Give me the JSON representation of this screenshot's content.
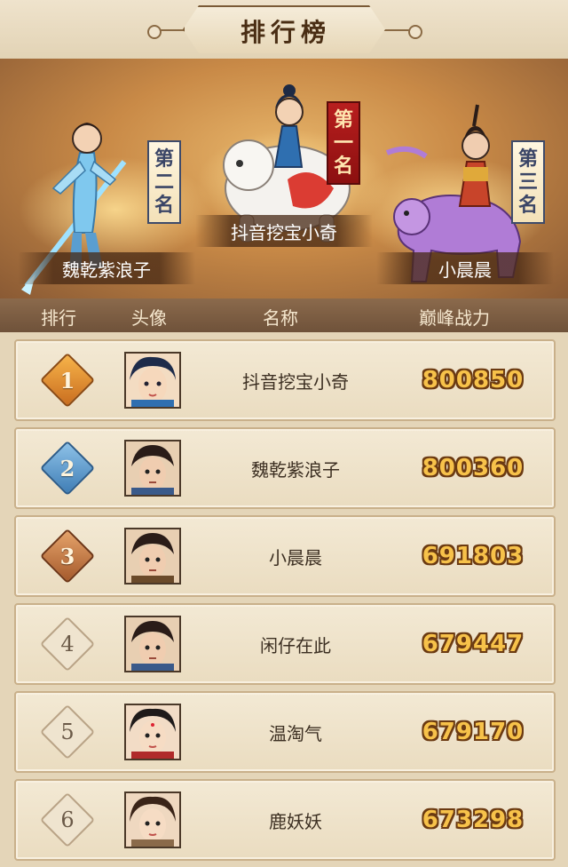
{
  "title": "排行榜",
  "podium": [
    {
      "place_chars": [
        "第",
        "二",
        "名"
      ],
      "name": "魏乾紫浪子"
    },
    {
      "place_chars": [
        "第",
        "一",
        "名"
      ],
      "name": "抖音挖宝小奇"
    },
    {
      "place_chars": [
        "第",
        "三",
        "名"
      ],
      "name": "小晨晨"
    }
  ],
  "columns": {
    "rank": "排行",
    "avatar": "头像",
    "name": "名称",
    "power": "巅峰战力"
  },
  "rows": [
    {
      "rank": "1",
      "name": "抖音挖宝小奇",
      "power": "800850"
    },
    {
      "rank": "2",
      "name": "魏乾紫浪子",
      "power": "800360"
    },
    {
      "rank": "3",
      "name": "小晨晨",
      "power": "691803"
    },
    {
      "rank": "4",
      "name": "闲仔在此",
      "power": "679447"
    },
    {
      "rank": "5",
      "name": "温淘气",
      "power": "679170"
    },
    {
      "rank": "6",
      "name": "鹿妖妖",
      "power": "673298"
    }
  ],
  "colors": {
    "gold": "#f7c24a",
    "header_bar": "#7b5c42",
    "row_bg": "#f0e4cc"
  }
}
